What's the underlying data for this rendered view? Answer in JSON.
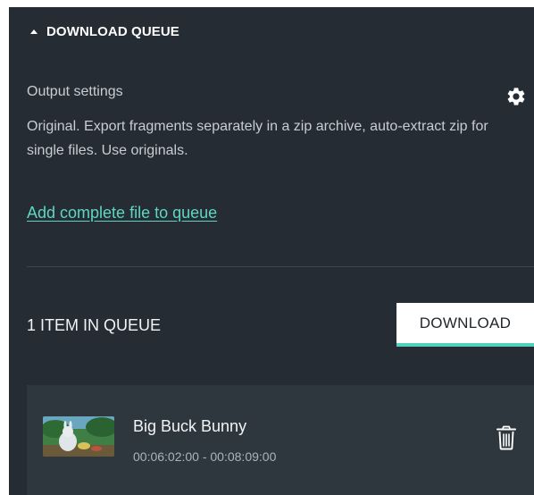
{
  "queue": {
    "header_title": "DOWNLOAD QUEUE",
    "settings_title": "Output settings",
    "settings_description": "Original. Export fragments separately in a zip archive, auto-extract zip for single files. Use originals.",
    "add_link": "Add complete file to queue",
    "count_label": "1 ITEM IN QUEUE",
    "download_label": "DOWNLOAD"
  },
  "items": [
    {
      "title": "Big Buck Bunny",
      "range": "00:06:02:00 - 00:08:09:00"
    }
  ],
  "icons": {
    "header": "caret-up-icon",
    "settings": "gear-icon",
    "remove": "trash-icon"
  },
  "colors": {
    "panel": "#252c33",
    "accent": "#5fd6c2",
    "item_background": "#2e363e"
  }
}
